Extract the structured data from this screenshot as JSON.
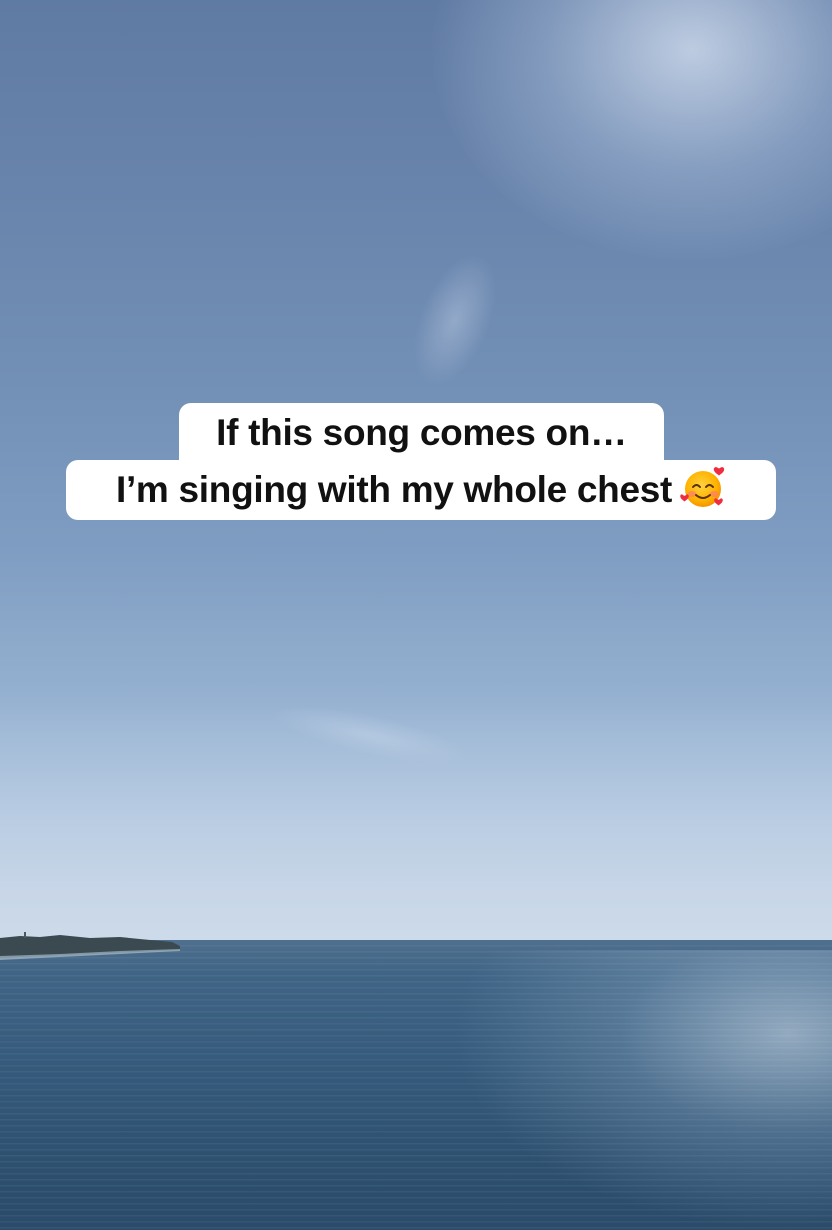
{
  "scene": {
    "description_icons": [
      "smiling-face-with-hearts-icon"
    ],
    "colors": {
      "sky_top": "#5f7aa3",
      "sky_horizon": "#c8d6e6",
      "sea": "#2f5272",
      "caption_background": "#ffffff",
      "caption_text": "#111111"
    }
  },
  "caption": {
    "line1": "If this song comes on…",
    "line2": "I’m singing with my whole chest",
    "emoji_icon": "smiling-face-with-hearts-icon"
  }
}
